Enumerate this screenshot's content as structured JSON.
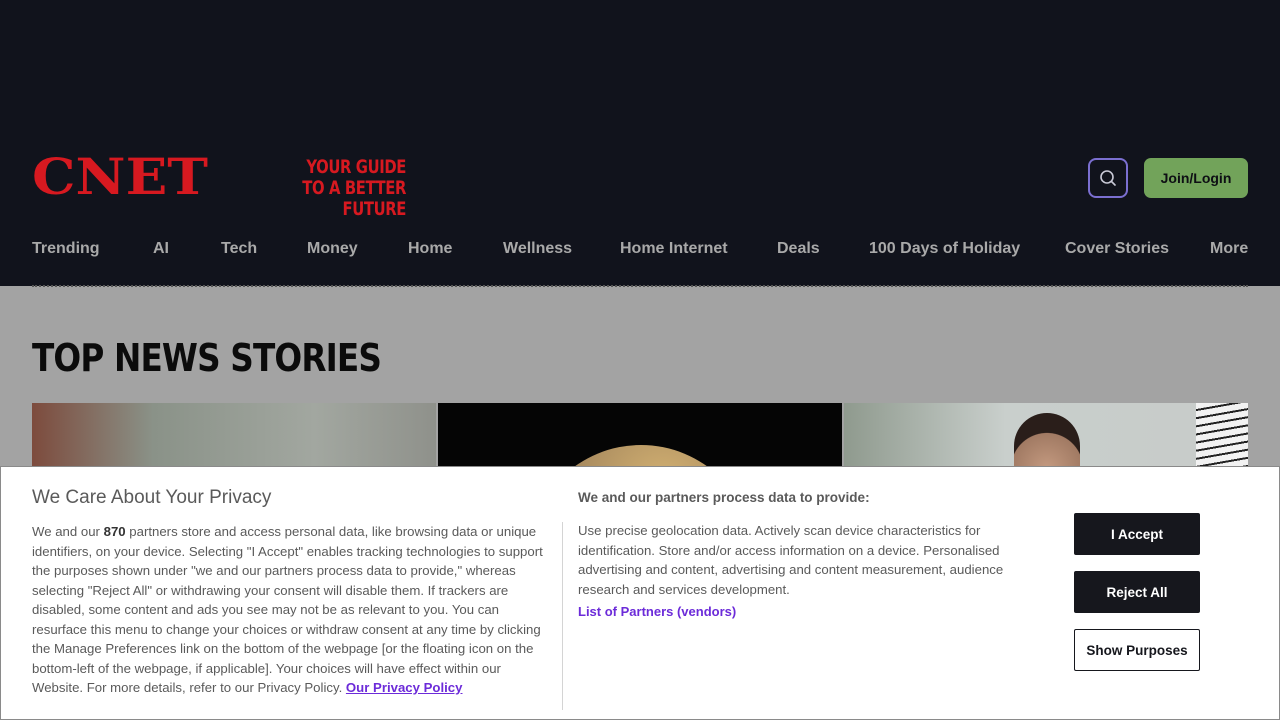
{
  "header": {
    "logo_text": "CNET",
    "tagline_line1": "YOUR GUIDE",
    "tagline_line2": "TO A BETTER FUTURE",
    "join_label": "Join/Login",
    "brand_color": "#d71920",
    "join_color": "#72a35a"
  },
  "nav": {
    "items": [
      "Trending",
      "AI",
      "Tech",
      "Money",
      "Home",
      "Wellness",
      "Home Internet",
      "Deals",
      "100 Days of Holiday",
      "Cover Stories",
      "More"
    ]
  },
  "main": {
    "section_title": "TOP NEWS STORIES"
  },
  "privacy": {
    "title": "We Care About Your Privacy",
    "body_pre": "We and our ",
    "partner_count": "870",
    "body_post": " partners store and access personal data, like browsing data or unique identifiers, on your device. Selecting \"I Accept\" enables tracking technologies to support the purposes shown under \"we and our partners process data to provide,\" whereas selecting \"Reject All\" or withdrawing your consent will disable them. If trackers are disabled, some content and ads you see may not be as relevant to you. You can resurface this menu to change your choices or withdraw consent at any time by clicking the Manage Preferences link on the bottom of the webpage [or the floating icon on the bottom-left of the webpage, if applicable]. Your choices will have effect within our Website. For more details, refer to our Privacy Policy. ",
    "policy_link": "Our Privacy Policy",
    "process_heading": "We and our partners process data to provide:",
    "purposes_text": "Use precise geolocation data. Actively scan device characteristics for identification. Store and/or access information on a device. Personalised advertising and content, advertising and content measurement, audience research and services development.",
    "partners_link": "List of Partners (vendors)",
    "accept_label": "I Accept",
    "reject_label": "Reject All",
    "purposes_label": "Show Purposes",
    "link_color": "#6c2bd9"
  }
}
